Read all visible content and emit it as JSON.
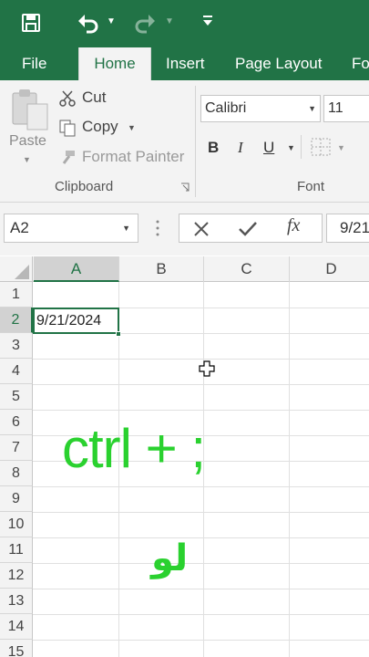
{
  "quick_access": {
    "icons": [
      "save-icon",
      "undo-icon",
      "redo-icon",
      "customize-icon"
    ]
  },
  "tabs": [
    {
      "label": "File",
      "active": false
    },
    {
      "label": "Home",
      "active": true
    },
    {
      "label": "Insert",
      "active": false
    },
    {
      "label": "Page Layout",
      "active": false
    },
    {
      "label": "Fo",
      "active": false
    }
  ],
  "clipboard": {
    "paste_label": "Paste",
    "cut_label": "Cut",
    "copy_label": "Copy",
    "format_painter_label": "Format Painter",
    "group_label": "Clipboard"
  },
  "font": {
    "name": "Calibri",
    "size": "11",
    "bold_label": "B",
    "italic_label": "I",
    "underline_label": "U",
    "group_label": "Font"
  },
  "formula_bar": {
    "name_box": "A2",
    "fx_label": "fx",
    "value": "9/21/2024"
  },
  "grid": {
    "columns": [
      "A",
      "B",
      "C",
      "D"
    ],
    "rows": [
      "1",
      "2",
      "3",
      "4",
      "5",
      "6",
      "7",
      "8",
      "9",
      "10",
      "11",
      "12",
      "13",
      "14",
      "15"
    ],
    "selected_cell": "A2",
    "cell_a2_value": "9/21/2024"
  },
  "overlay": {
    "shortcut_text": "ctrl + ;",
    "arabic_text": "لو",
    "color": "#2ad12f"
  },
  "colors": {
    "accent": "#217346"
  }
}
